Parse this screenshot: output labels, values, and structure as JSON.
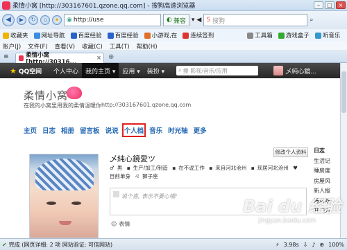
{
  "window": {
    "title": "柔情小窝 [http://303167601.qzone.qq.com] - 搜狗高速浏览器"
  },
  "address": {
    "url": "http://use",
    "compat_label": "兼容",
    "search_placeholder": "搜狗"
  },
  "favorites": [
    "收藏夹",
    "网址导航",
    "百度经验",
    "百度经验",
    "小游戏,在",
    "连续签到",
    "工具箱",
    "游戏盒子",
    "听音乐"
  ],
  "menu": [
    "账户(J)",
    "文件(F)",
    "查看(V)",
    "收藏(C)",
    "工具(T)",
    "帮助(H)"
  ],
  "tab": {
    "label": "柔情小窝 [http://30316..."
  },
  "qq": {
    "logo": "QQ空间",
    "nav": [
      "个人中心",
      "我的主页 ▾",
      "应用 ▾",
      "装扮 ▾"
    ],
    "search_placeholder": "搜 影视/音乐/应用",
    "user": "乄純心鏡..."
  },
  "space": {
    "title": "柔情小窝",
    "subtitle": "在我的小窝里用我的柔情温暖你",
    "url": "http://303167601.qzone.qq.com",
    "nav": [
      "主页",
      "日志",
      "相册",
      "留言板",
      "说说",
      "个人档",
      "音乐",
      "时光轴",
      "更多"
    ],
    "highlighted_nav": "个人档"
  },
  "profile": {
    "name": "乄純心鏡愛ツ",
    "edit_button": "修改个人资料",
    "info": [
      "男",
      "生产/加工/制造",
      "在不说工作",
      "来自河北沧州",
      "现居河北沧州",
      "目前单身",
      "狮子座"
    ],
    "status_placeholder": "说个喜, 表示不要心哦!",
    "mood_label": "表情"
  },
  "right_column": [
    "日志",
    "生活记",
    "睡房度",
    "房屋风",
    "新人报",
    "隔房吃",
    "开门为"
  ],
  "watermark": {
    "brand": "Bai du 经验",
    "site": "jingyan.baidu.com"
  },
  "statusbar": {
    "left": "完成 (网页详细: 2 项 网站验证: 可信网站)",
    "speed": "3.98s",
    "zoom": "100%"
  }
}
